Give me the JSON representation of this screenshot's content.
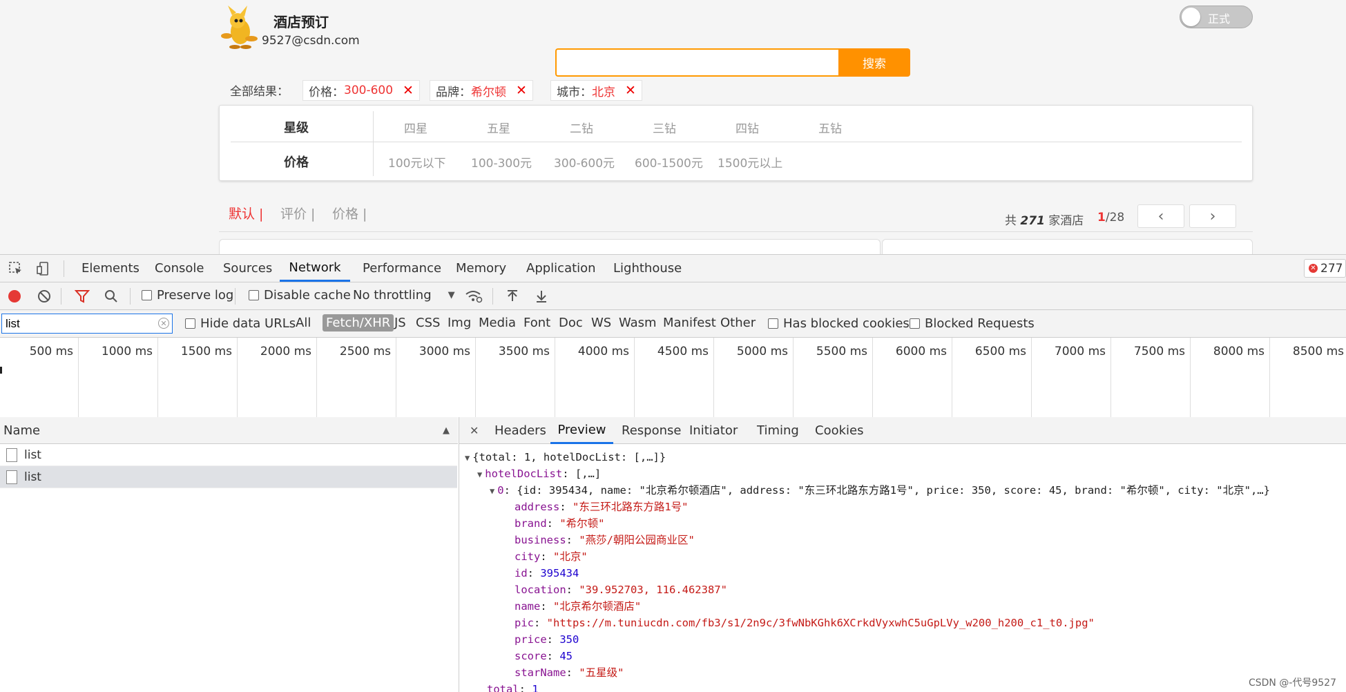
{
  "webpage": {
    "app_title": "酒店预订",
    "user_email": "9527@csdn.com",
    "search": {
      "placeholder": "",
      "button_label": "搜索"
    },
    "toggle_label": "正式",
    "all_results_label": "全部结果：",
    "active_filters": [
      {
        "key": "价格：",
        "value": "300-600",
        "remove": "✕"
      },
      {
        "key": "品牌：",
        "value": "希尔顿",
        "remove": "✕"
      },
      {
        "key": "城市：",
        "value": "北京",
        "remove": "✕"
      }
    ],
    "filter_rows": [
      {
        "label": "星级",
        "options": [
          "四星",
          "五星",
          "二钻",
          "三钻",
          "四钻",
          "五钻"
        ]
      },
      {
        "label": "价格",
        "options": [
          "100元以下",
          "100-300元",
          "300-600元",
          "600-1500元",
          "1500元以上"
        ]
      }
    ],
    "sort_options": [
      "默认 |",
      "评价 |",
      "价格 |"
    ],
    "hotel_count": {
      "prefix": "共 ",
      "count": "271",
      "suffix": " 家酒店"
    },
    "pagination": {
      "current": "1",
      "total": "/28",
      "prev": "‹",
      "next": "›"
    }
  },
  "devtools": {
    "tabs": [
      "Elements",
      "Console",
      "Sources",
      "Network",
      "Performance",
      "Memory",
      "Application",
      "Lighthouse"
    ],
    "active_tab": "Network",
    "error_count": "277",
    "toolbar": {
      "preserve_log": "Preserve log",
      "disable_cache": "Disable cache",
      "throttling": "No throttling",
      "throttling_arrow": "▼"
    },
    "filter": {
      "value": "list",
      "hide_data_urls": "Hide data URLs",
      "types": [
        "All",
        "Fetch/XHR",
        "JS",
        "CSS",
        "Img",
        "Media",
        "Font",
        "Doc",
        "WS",
        "Wasm",
        "Manifest",
        "Other"
      ],
      "active_type": "Fetch/XHR",
      "has_blocked_cookies": "Has blocked cookies",
      "blocked_requests": "Blocked Requests"
    },
    "timeline_labels": [
      "500 ms",
      "1000 ms",
      "1500 ms",
      "2000 ms",
      "2500 ms",
      "3000 ms",
      "3500 ms",
      "4000 ms",
      "4500 ms",
      "5000 ms",
      "5500 ms",
      "6000 ms",
      "6500 ms",
      "7000 ms",
      "7500 ms",
      "8000 ms",
      "8500 ms"
    ],
    "requests": {
      "header": "Name",
      "sort_arrow": "▲",
      "rows": [
        "list",
        "list"
      ]
    },
    "detail_tabs": [
      "Headers",
      "Preview",
      "Response",
      "Initiator",
      "Timing",
      "Cookies"
    ],
    "active_detail_tab": "Preview",
    "close_glyph": "✕",
    "preview": {
      "root_summary": "{total: 1, hotelDocList: [,…]}",
      "list_key": "hotelDocList",
      "list_summary": "[,…]",
      "item_key": "0",
      "item_summary": "{id: 395434, name: \"北京希尔顿酒店\", address: \"东三环北路东方路1号\", price: 350, score: 45, brand: \"希尔顿\", city: \"北京\",…}",
      "fields": [
        {
          "key": "address",
          "value": "\"东三环北路东方路1号\"",
          "kind": "string"
        },
        {
          "key": "brand",
          "value": "\"希尔顿\"",
          "kind": "string"
        },
        {
          "key": "business",
          "value": "\"燕莎/朝阳公园商业区\"",
          "kind": "string"
        },
        {
          "key": "city",
          "value": "\"北京\"",
          "kind": "string"
        },
        {
          "key": "id",
          "value": "395434",
          "kind": "number"
        },
        {
          "key": "location",
          "value": "\"39.952703, 116.462387\"",
          "kind": "string"
        },
        {
          "key": "name",
          "value": "\"北京希尔顿酒店\"",
          "kind": "string"
        },
        {
          "key": "pic",
          "value": "\"https://m.tuniucdn.com/fb3/s1/2n9c/3fwNbKGhk6XCrkdVyxwhC5uGpLVy_w200_h200_c1_t0.jpg\"",
          "kind": "string"
        },
        {
          "key": "price",
          "value": "350",
          "kind": "number"
        },
        {
          "key": "score",
          "value": "45",
          "kind": "number"
        },
        {
          "key": "starName",
          "value": "\"五星级\"",
          "kind": "string"
        }
      ],
      "total_key": "total",
      "total_value": "1"
    }
  },
  "watermark": "CSDN @-代号9527"
}
